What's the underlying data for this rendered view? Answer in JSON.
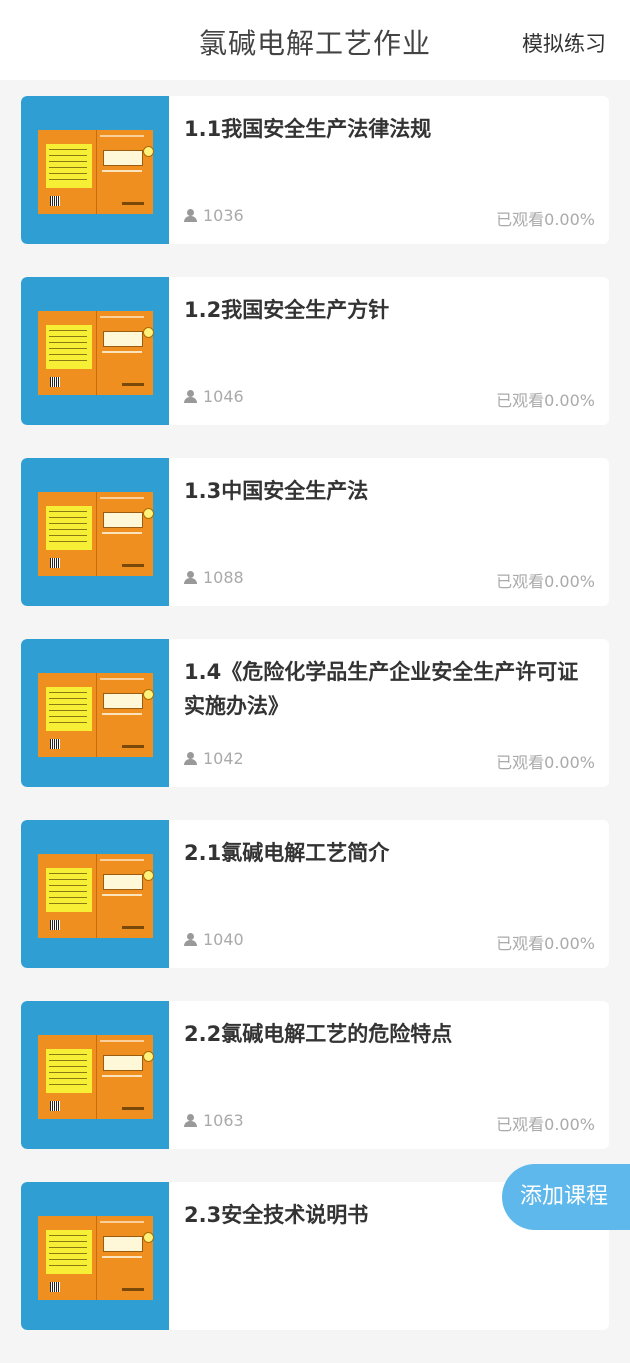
{
  "header": {
    "title": "氯碱电解工艺作业",
    "practice_label": "模拟练习"
  },
  "courses": [
    {
      "title": "1.1我国安全生产法律法规",
      "views": "1036",
      "progress": "已观看0.00%"
    },
    {
      "title": "1.2我国安全生产方针",
      "views": "1046",
      "progress": "已观看0.00%"
    },
    {
      "title": "1.3中国安全生产法",
      "views": "1088",
      "progress": "已观看0.00%"
    },
    {
      "title": "1.4《危险化学品生产企业安全生产许可证实施办法》",
      "views": "1042",
      "progress": "已观看0.00%"
    },
    {
      "title": "2.1氯碱电解工艺简介",
      "views": "1040",
      "progress": "已观看0.00%"
    },
    {
      "title": "2.2氯碱电解工艺的危险特点",
      "views": "1063",
      "progress": "已观看0.00%"
    },
    {
      "title": "2.3安全技术说明书",
      "views": "",
      "progress": ""
    }
  ],
  "fab": {
    "label": "添加课程"
  }
}
